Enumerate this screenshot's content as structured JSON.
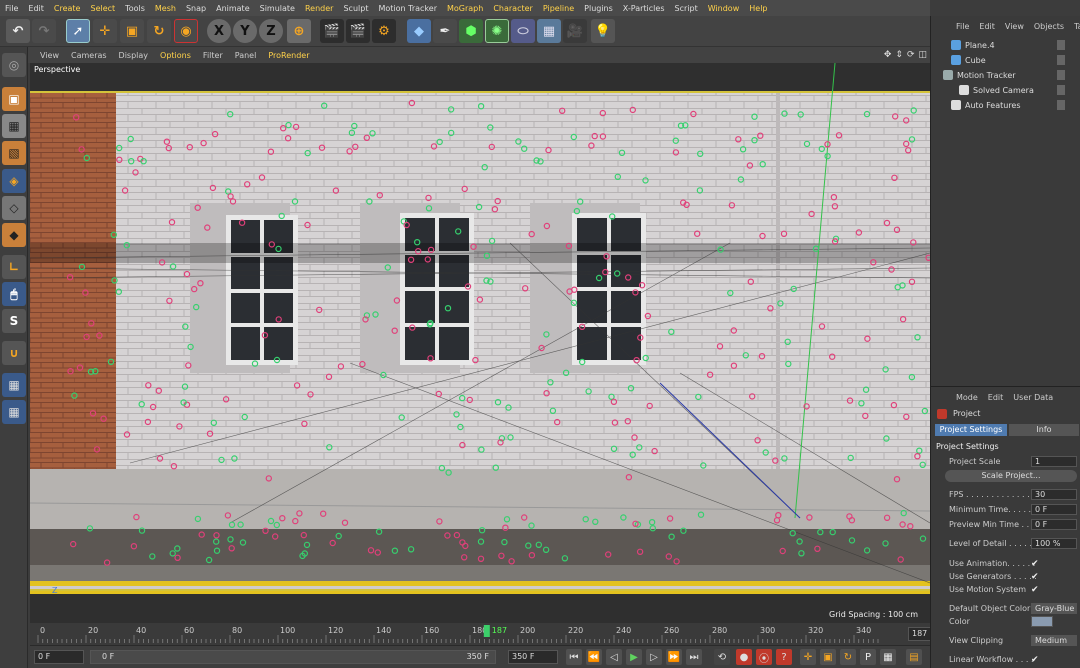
{
  "menubar": [
    "File",
    "Edit",
    "Create",
    "Select",
    "Tools",
    "Mesh",
    "Snap",
    "Animate",
    "Simulate",
    "Render",
    "Sculpt",
    "Motion Tracker",
    "MoGraph",
    "Character",
    "Pipeline",
    "Plugins",
    "X-Particles",
    "Script",
    "Window",
    "Help"
  ],
  "menubar_highlight": [
    "Create",
    "Select",
    "Mesh",
    "Render",
    "MoGraph",
    "Character",
    "Pipeline",
    "Window",
    "Help"
  ],
  "toolbar": {
    "axis_x": "X",
    "axis_y": "Y",
    "axis_z": "Z"
  },
  "left_tools": {
    "snap": "S"
  },
  "viewport_menu": [
    "View",
    "Cameras",
    "Display",
    "Options",
    "Filter",
    "Panel",
    "ProRender"
  ],
  "viewport_menu_highlight": [
    "Options",
    "ProRender"
  ],
  "viewport": {
    "label": "Perspective",
    "grid_spacing": "Grid Spacing : 100 cm",
    "axis_label": "Z"
  },
  "timeline": {
    "ticks": [
      "0",
      "20",
      "40",
      "60",
      "80",
      "100",
      "120",
      "140",
      "160",
      "180",
      "200",
      "220",
      "240",
      "260",
      "280",
      "300",
      "320",
      "340"
    ],
    "current_frame": "187",
    "end_frame": "187 F"
  },
  "playbar": {
    "start": "0 F",
    "slider_start": "0 F",
    "slider_end": "350 F",
    "max": "350 F"
  },
  "objects_menu": [
    "File",
    "Edit",
    "View",
    "Objects",
    "Tags"
  ],
  "objects": [
    {
      "name": "Plane.4",
      "indent": 1
    },
    {
      "name": "Cube",
      "indent": 1
    },
    {
      "name": "Motion Tracker",
      "indent": 0
    },
    {
      "name": "Solved Camera",
      "indent": 2
    },
    {
      "name": "Auto Features",
      "indent": 1
    }
  ],
  "attr_menu": [
    "Mode",
    "Edit",
    "User Data"
  ],
  "attr_title": "Project",
  "attr_tabs": [
    "Project Settings",
    "Info"
  ],
  "attr_section": "Project Settings",
  "attrs": {
    "project_scale_label": "Project Scale",
    "project_scale_value": "1",
    "scale_button": "Scale Project...",
    "fps_label": "FPS . . . . . . . . . . . . .",
    "fps_value": "30",
    "min_time_label": "Minimum Time. . . . . .",
    "min_time_value": "0 F",
    "preview_min_label": "Preview Min Time . .",
    "preview_min_value": "0 F",
    "lod_label": "Level of Detail . . . . . .",
    "lod_value": "100 %",
    "use_anim_label": "Use Animation. . . . . .",
    "use_gen_label": "Use Generators . . . . .",
    "use_motion_label": "Use Motion System",
    "check": "✔",
    "def_color_label": "Default Object Color",
    "def_color_value": "Gray-Blue",
    "color_label": "Color",
    "view_clip_label": "View Clipping",
    "view_clip_value": "Medium",
    "linear_label": "Linear Workflow . . . ."
  }
}
